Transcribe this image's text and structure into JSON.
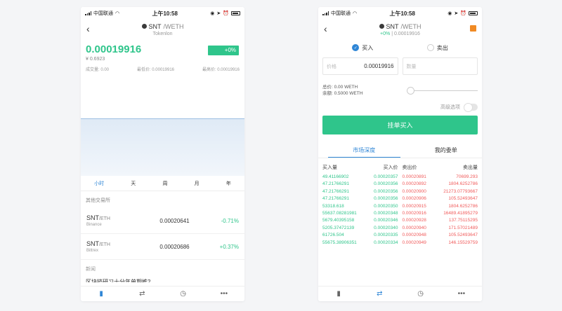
{
  "status": {
    "carrier": "中国联通",
    "time": "上午10:58"
  },
  "screen1": {
    "title_main": "SNT",
    "title_sub": "/WETH",
    "subtitle": "Tokenlon",
    "price": "0.00019916",
    "cny_price": "¥ 0.6923",
    "change_badge": "+0%",
    "stats": {
      "volume": "成交量: 0.00",
      "low": "最低价: 0.00019916",
      "high": "最高价: 0.00019916"
    },
    "periods": [
      "小时",
      "天",
      "周",
      "月",
      "年"
    ],
    "other_exchanges_label": "其他交易所",
    "exchanges": [
      {
        "pair": "SNT",
        "quote": "/ETH",
        "exchange": "Binance",
        "price": "0.00020641",
        "change": "-0.71%"
      },
      {
        "pair": "SNT",
        "quote": "/ETH",
        "exchange": "Bittrex",
        "price": "0.00020686",
        "change": "+0.37%"
      }
    ],
    "news_label": "新闻",
    "news_cut": "区块链研习十分年单期推2"
  },
  "screen2": {
    "title_main": "SNT",
    "title_sub": "/WETH",
    "change": "+0%",
    "sub_price": "0.00019916",
    "buy_label": "买入",
    "sell_label": "卖出",
    "price_field": {
      "label": "价格",
      "value": "0.00019916"
    },
    "qty_placeholder": "数量",
    "total": "总价: 0.00 WETH",
    "balance": "余额: 0.5000 WETH",
    "advanced_label": "高级选项",
    "submit_label": "挂单买入",
    "tabs": [
      "市场深度",
      "我的委单"
    ],
    "depth_headers": [
      "买入量",
      "买入价",
      "卖出价",
      "卖出量"
    ],
    "depth_rows": [
      [
        "49.41166902",
        "0.00020357",
        "0.00020891",
        "70699.293"
      ],
      [
        "47.21766291",
        "0.00020356",
        "0.00020892",
        "1804.6252786"
      ],
      [
        "47.21766291",
        "0.00020356",
        "0.00020900",
        "21273.07793667"
      ],
      [
        "47.21766291",
        "0.00020356",
        "0.00020906",
        "105.52493647"
      ],
      [
        "53318.618",
        "0.00020350",
        "0.00020915",
        "1804.6252786"
      ],
      [
        "55637.08281981",
        "0.00020348",
        "0.00020916",
        "16489.41895279"
      ],
      [
        "5679.40395158",
        "0.00020346",
        "0.00020928",
        "137.75115295"
      ],
      [
        "5205.37472139",
        "0.00020340",
        "0.00020940",
        "171.57021489"
      ],
      [
        "61726.504",
        "0.00020335",
        "0.00020948",
        "105.52493647"
      ],
      [
        "55675.38906351",
        "0.00020334",
        "0.00020949",
        "146.15529759"
      ]
    ]
  }
}
